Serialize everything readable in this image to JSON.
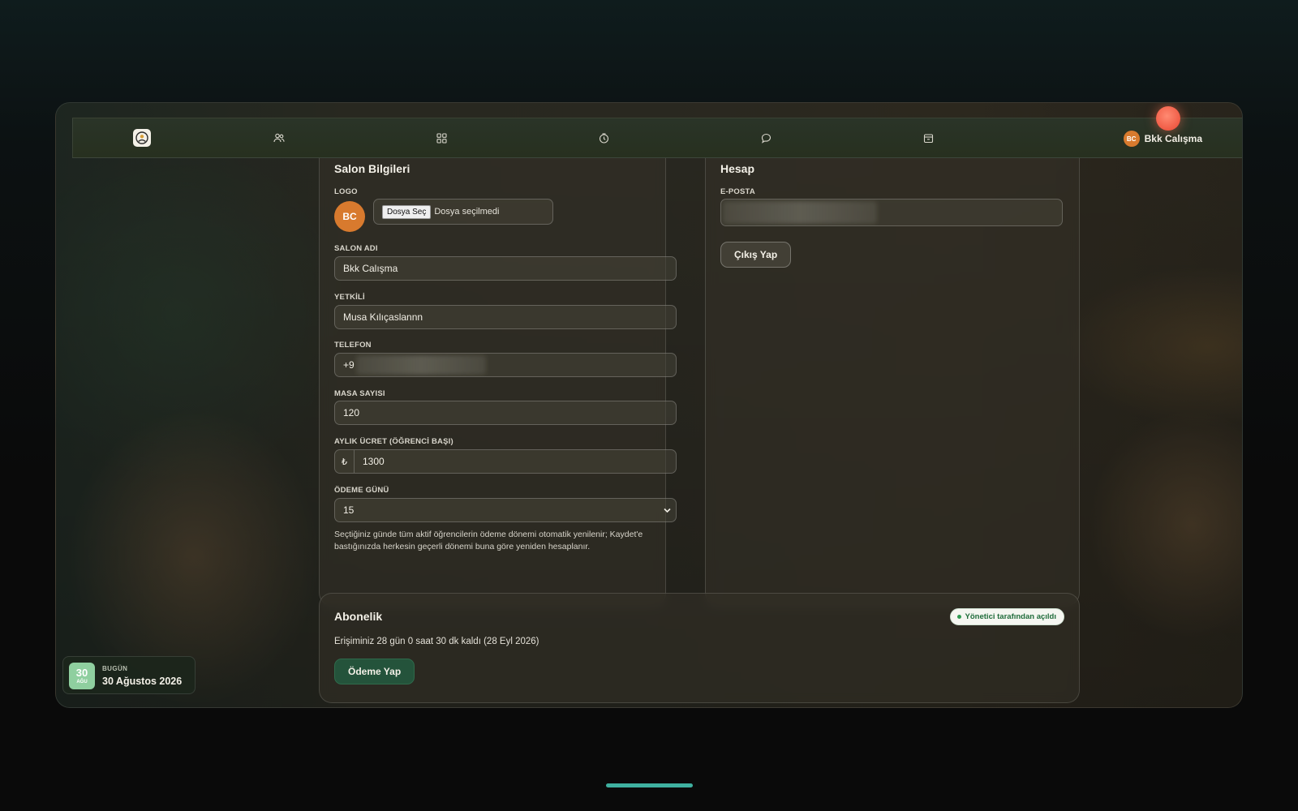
{
  "header": {
    "user_initials": "BC",
    "user_name": "Bkk Calışma"
  },
  "nav": {
    "icons": [
      "users-icon",
      "grid-icon",
      "clock-icon",
      "chat-icon",
      "calendar-icon"
    ]
  },
  "salon": {
    "title": "Salon Bilgileri",
    "logo_label": "LOGO",
    "logo_initials": "BC",
    "file_button": "Dosya Seç",
    "file_status": "Dosya seçilmedi",
    "name_label": "SALON ADI",
    "name_value": "Bkk Calışma",
    "manager_label": "YETKİLİ",
    "manager_value": "Musa Kılıçaslannn",
    "phone_label": "TELEFON",
    "phone_prefix": "+9",
    "table_label": "MASA SAYISI",
    "table_value": "120",
    "fee_label": "AYLIK ÜCRET (ÖĞRENCİ BAŞI)",
    "fee_currency": "₺",
    "fee_value": "1300",
    "payday_label": "ÖDEME GÜNÜ",
    "payday_value": "15",
    "helper_text_1": "Seçtiğiniz günde tüm aktif öğrencilerin ödeme dönemi otomatik yenilenir; Kaydet'e",
    "helper_text_2": "bastığınızda herkesin geçerli dönemi buna göre yeniden hesaplanır."
  },
  "account": {
    "title": "Hesap",
    "email_label": "E-POSTA",
    "logout_button": "Çıkış Yap"
  },
  "subscription": {
    "title": "Abonelik",
    "badge": "Yönetici tarafından açıldı",
    "remaining": "Erişiminiz 28 gün 0 saat 30 dk kaldı (28 Eyl 2026)",
    "pay_button": "Ödeme Yap"
  },
  "date_widget": {
    "day": "30",
    "month_short": "AĞU",
    "label": "BUGÜN",
    "full_date": "30 Ağustos 2026"
  },
  "colors": {
    "accent_orange": "#d87a2e",
    "primary_green": "#24533b",
    "badge_green": "#1f6b3a",
    "notification": "#f05b45",
    "home_indicator": "#3fb0a0"
  }
}
